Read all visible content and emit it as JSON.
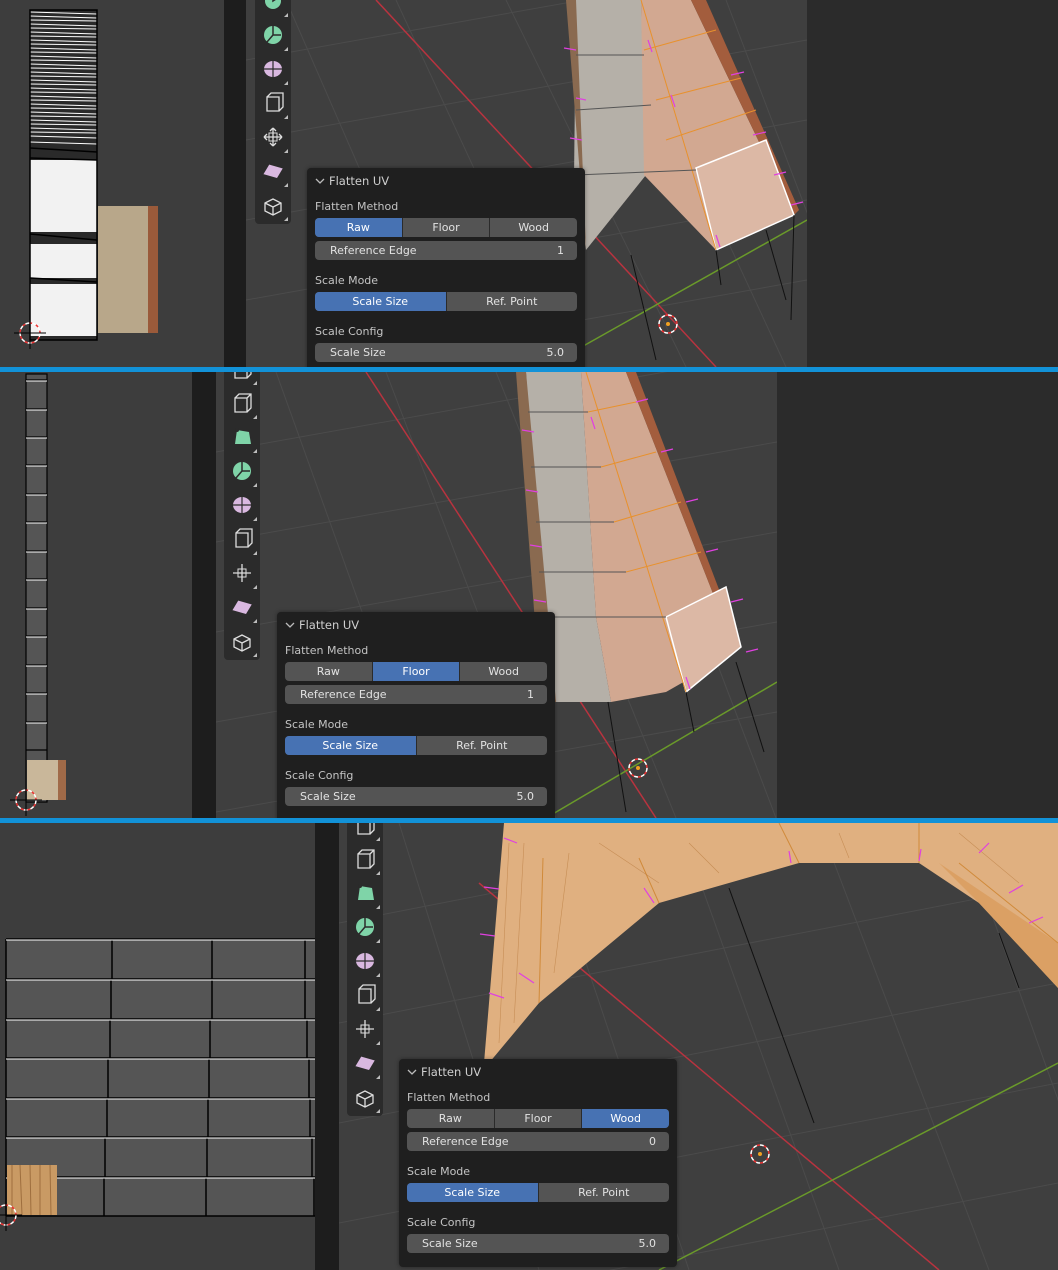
{
  "screens": [
    {
      "panel": {
        "title": "Flatten UV",
        "flatten_method_label": "Flatten Method",
        "flatten_methods": [
          "Raw",
          "Floor",
          "Wood"
        ],
        "flatten_method_selected": "Raw",
        "reference_edge_label": "Reference Edge",
        "reference_edge_value": "1",
        "scale_mode_label": "Scale Mode",
        "scale_modes": [
          "Scale Size",
          "Ref. Point"
        ],
        "scale_mode_selected": "Scale Size",
        "scale_config_label": "Scale Config",
        "scale_size_label": "Scale Size",
        "scale_size_value": "5.0"
      }
    },
    {
      "panel": {
        "title": "Flatten UV",
        "flatten_method_label": "Flatten Method",
        "flatten_methods": [
          "Raw",
          "Floor",
          "Wood"
        ],
        "flatten_method_selected": "Floor",
        "reference_edge_label": "Reference Edge",
        "reference_edge_value": "1",
        "scale_mode_label": "Scale Mode",
        "scale_modes": [
          "Scale Size",
          "Ref. Point"
        ],
        "scale_mode_selected": "Scale Size",
        "scale_config_label": "Scale Config",
        "scale_size_label": "Scale Size",
        "scale_size_value": "5.0"
      }
    },
    {
      "panel": {
        "title": "Flatten UV",
        "flatten_method_label": "Flatten Method",
        "flatten_methods": [
          "Raw",
          "Floor",
          "Wood"
        ],
        "flatten_method_selected": "Wood",
        "reference_edge_label": "Reference Edge",
        "reference_edge_value": "0",
        "scale_mode_label": "Scale Mode",
        "scale_modes": [
          "Scale Size",
          "Ref. Point"
        ],
        "scale_mode_selected": "Scale Size",
        "scale_config_label": "Scale Config",
        "scale_size_label": "Scale Size",
        "scale_size_value": "5.0"
      }
    }
  ],
  "toolbar_icons": [
    "select-box-icon",
    "rip-region-icon",
    "spin-icon",
    "smooth-icon",
    "shrink-fatten-icon",
    "edge-slide-icon",
    "push-pull-icon",
    "shear-icon",
    "extrude-icon"
  ],
  "colors": {
    "accent": "#4772b3",
    "separator": "#1292d8",
    "x_axis": "#b8333f",
    "y_axis": "#6a9a2a",
    "selection": "#e8912d",
    "normals": "#e040e0"
  }
}
